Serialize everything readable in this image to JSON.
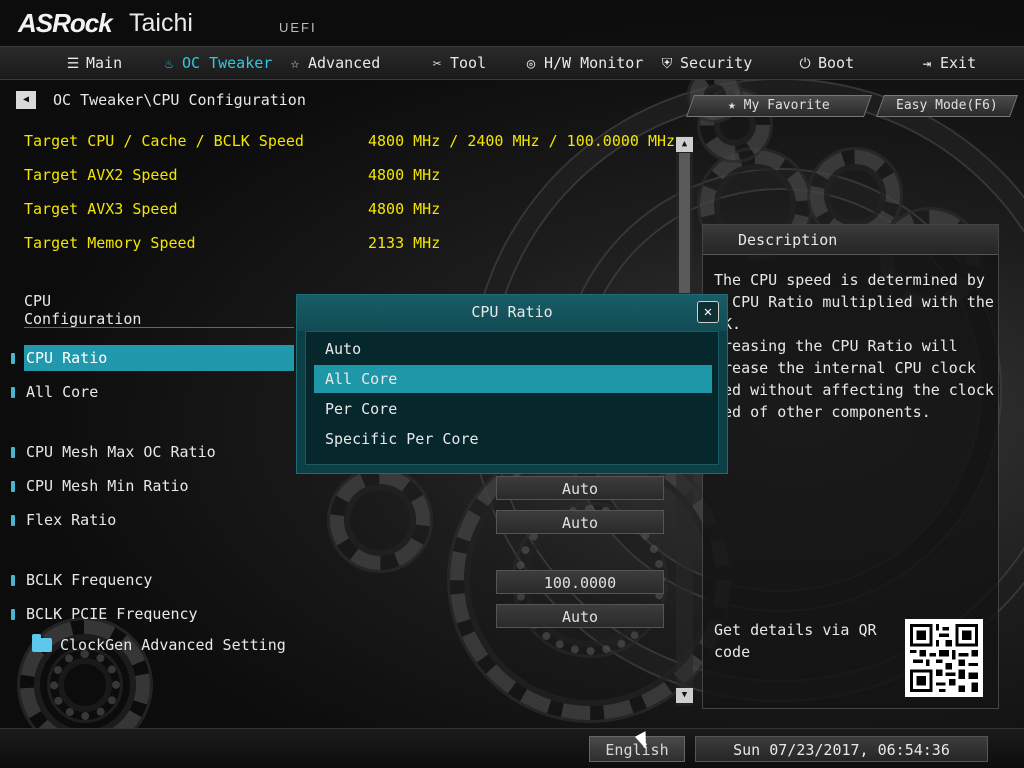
{
  "header": {
    "brand": "ASRock",
    "model": "Taichi",
    "firmware_label": "UEFI"
  },
  "nav": {
    "tabs": [
      {
        "label": "Main",
        "icon": "list-icon",
        "glyph": "☰"
      },
      {
        "label": "OC Tweaker",
        "icon": "flame-icon",
        "glyph": "🔥"
      },
      {
        "label": "Advanced",
        "icon": "star-icon",
        "glyph": "☆"
      },
      {
        "label": "Tool",
        "icon": "tools-icon",
        "glyph": "✂"
      },
      {
        "label": "H/W Monitor",
        "icon": "monitor-icon",
        "glyph": "◎"
      },
      {
        "label": "Security",
        "icon": "shield-icon",
        "glyph": "⛨"
      },
      {
        "label": "Boot",
        "icon": "power-icon",
        "glyph": "⏻"
      },
      {
        "label": "Exit",
        "icon": "exit-icon",
        "glyph": "⇥"
      }
    ],
    "active": "OC Tweaker"
  },
  "breadcrumb": {
    "back_glyph": "◀",
    "path": "OC Tweaker\\CPU Configuration"
  },
  "shortcuts": {
    "favorite": "★ My Favorite",
    "easy_mode": "Easy Mode(F6)"
  },
  "info": [
    {
      "label": "Target CPU / Cache / BCLK Speed",
      "value": "4800 MHz / 2400 MHz / 100.0000 MHz"
    },
    {
      "label": "Target AVX2 Speed",
      "value": "4800 MHz"
    },
    {
      "label": "Target AVX3 Speed",
      "value": "4800 MHz"
    },
    {
      "label": "Target Memory Speed",
      "value": "2133 MHz"
    }
  ],
  "section": {
    "title": "CPU Configuration"
  },
  "settings": [
    {
      "label": "CPU Ratio",
      "value": ""
    },
    {
      "label": "All Core",
      "value": ""
    },
    {
      "label": "CPU Mesh Max OC Ratio",
      "value": ""
    },
    {
      "label": "CPU Mesh Min Ratio",
      "value": "Auto"
    },
    {
      "label": "Flex Ratio",
      "value": "Auto"
    },
    {
      "label": "BCLK Frequency",
      "value": "100.0000"
    },
    {
      "label": "BCLK PCIE Frequency",
      "value": "Auto"
    }
  ],
  "submenu": {
    "label": "ClockGen Advanced Setting",
    "icon": "folder-icon"
  },
  "description": {
    "title": "Description",
    "text": "The CPU speed is determined by\ne CPU Ratio multiplied with the\nLK.\ncreasing the CPU Ratio will\ncrease the internal CPU clock\need without affecting the clock\need of other components.",
    "qr_text": "Get details via QR code"
  },
  "dialog": {
    "title": "CPU Ratio",
    "close_glyph": "✕",
    "options": [
      "Auto",
      "All Core",
      "Per Core",
      "Specific Per Core"
    ],
    "selected": "All Core"
  },
  "footer": {
    "language": "English",
    "datetime": "Sun 07/23/2017, 06:54:36"
  },
  "colors": {
    "accent": "#31c8e0",
    "info_text": "#f2e600",
    "highlight": "#2198ab",
    "dialog_bg": "#0c3f46"
  }
}
